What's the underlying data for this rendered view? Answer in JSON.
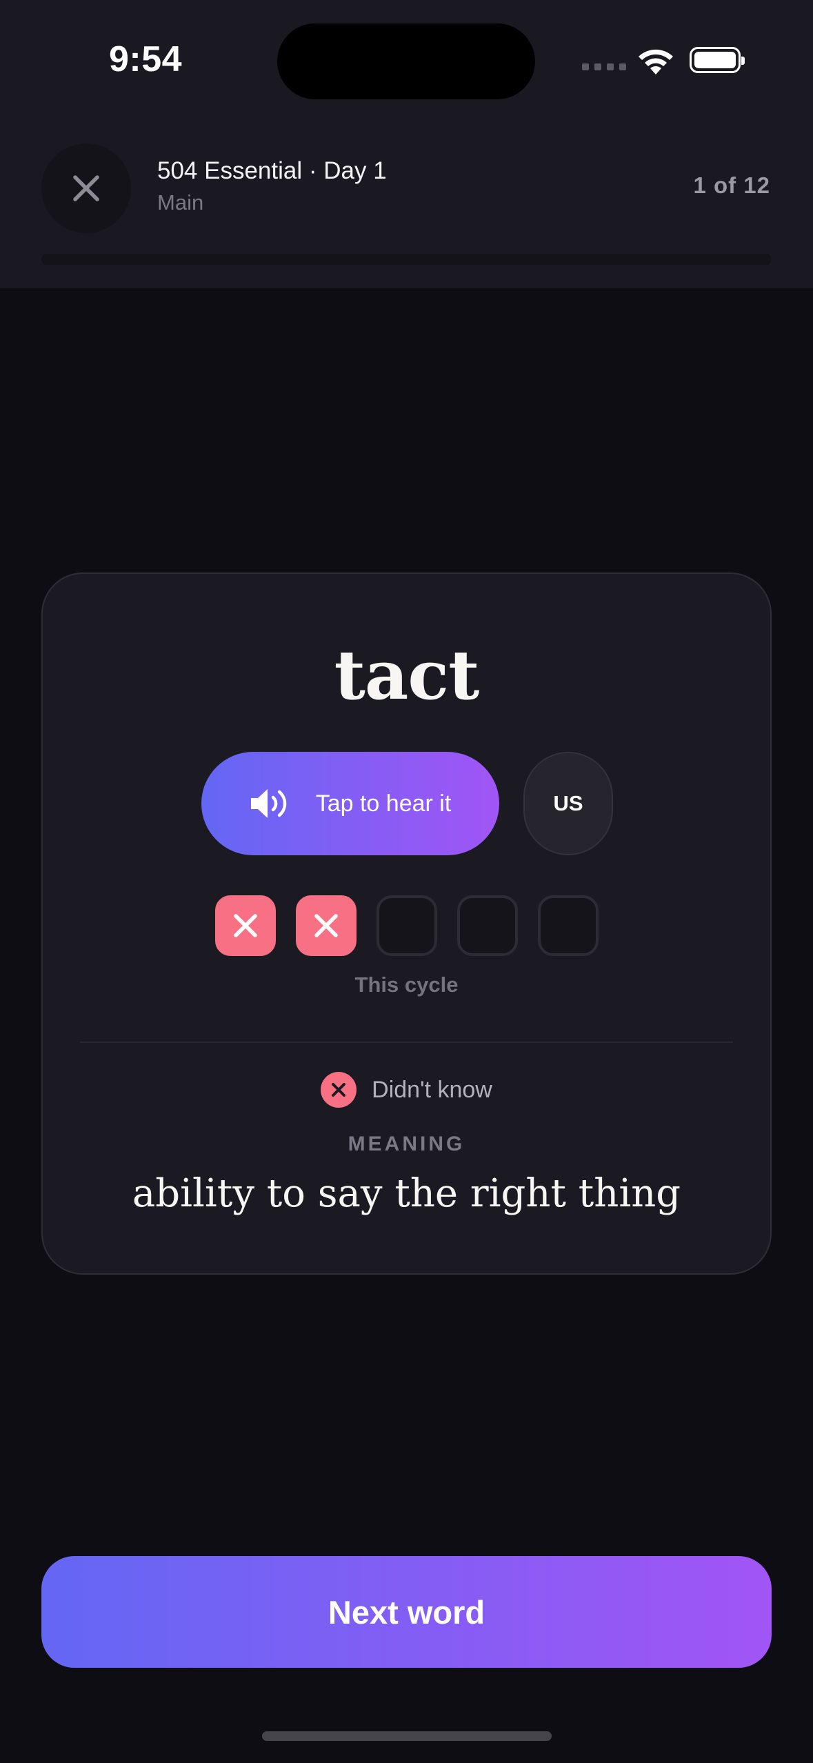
{
  "status_bar": {
    "time": "9:54"
  },
  "header": {
    "title": "504 Essential · Day 1",
    "subtitle": "Main",
    "counter": "1 of 12",
    "progress_fraction": 0
  },
  "card": {
    "word": "tact",
    "hear_button_label": "Tap to hear it",
    "accent_label": "US",
    "cycle": {
      "label": "This cycle",
      "results": [
        "wrong",
        "wrong",
        "empty",
        "empty",
        "empty"
      ]
    },
    "result": {
      "text": "Didn't know",
      "icon": "x-circle-icon"
    },
    "meaning_label": "MEANING",
    "meaning": "ability to say the right thing"
  },
  "footer": {
    "next_label": "Next word"
  },
  "colors": {
    "accent_start": "#6467f4",
    "accent_end": "#a155f5",
    "wrong": "#f77083",
    "background": "#0e0d13",
    "card": "#1b1a22"
  }
}
